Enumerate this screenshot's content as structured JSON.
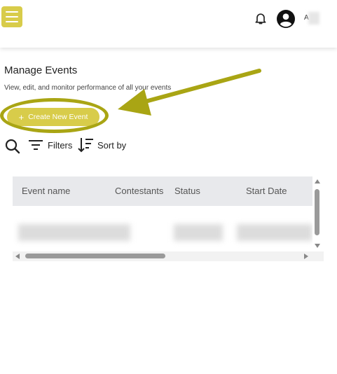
{
  "header": {
    "menu_icon": "hamburger-icon",
    "notification_icon": "bell-icon",
    "avatar_icon": "user-circle-icon",
    "user_initial": "A"
  },
  "page": {
    "title": "Manage Events",
    "subtitle": "View, edit, and monitor performance of all your events"
  },
  "actions": {
    "create_label": "Create New Event",
    "create_icon": "plus-icon"
  },
  "toolbar": {
    "search_icon": "search-icon",
    "filters_label": "Filters",
    "sort_label": "Sort by"
  },
  "table": {
    "columns": [
      "Event name",
      "Contestants",
      "Status",
      "Start Date"
    ]
  },
  "colors": {
    "accent": "#d8cc4a",
    "annotation": "#a9a514",
    "header_bg": "#e8e9ec"
  }
}
